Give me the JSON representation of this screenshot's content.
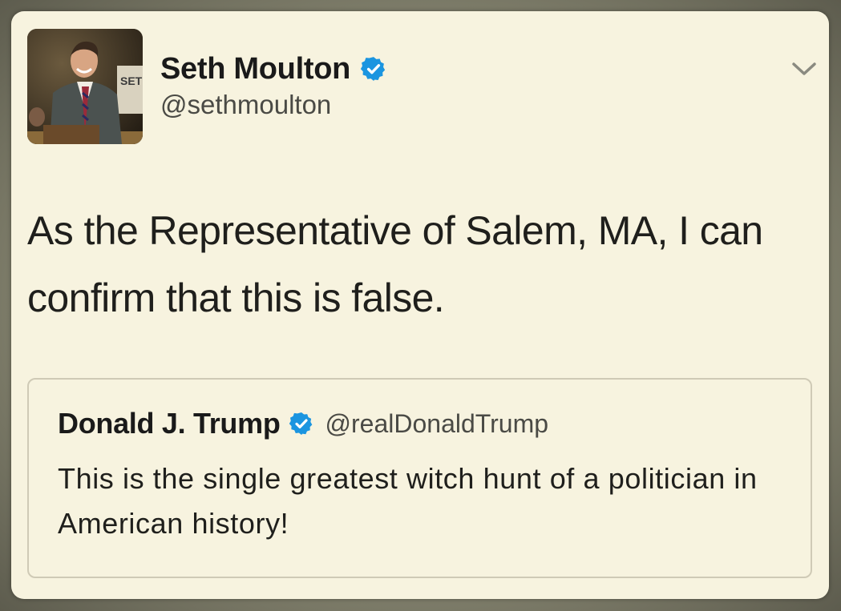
{
  "tweet": {
    "author_name": "Seth Moulton",
    "author_handle": "@sethmoulton",
    "avatar_sign_text": "SET",
    "text": "As the Representative of Salem, MA, I can confirm that this is false.",
    "verified_icon": "verified-badge-icon",
    "menu_icon": "chevron-down-icon"
  },
  "quoted_tweet": {
    "author_name": "Donald J. Trump",
    "author_handle": "@realDonaldTrump",
    "text": "This is the single greatest witch hunt of a politician in American history!",
    "verified_icon": "verified-badge-icon"
  },
  "colors": {
    "card_background": "#f7f3df",
    "verified_blue": "#1b95e0",
    "text_primary": "#1a1a1a",
    "text_secondary": "#4a4a45",
    "quote_border": "#cfcab6"
  }
}
